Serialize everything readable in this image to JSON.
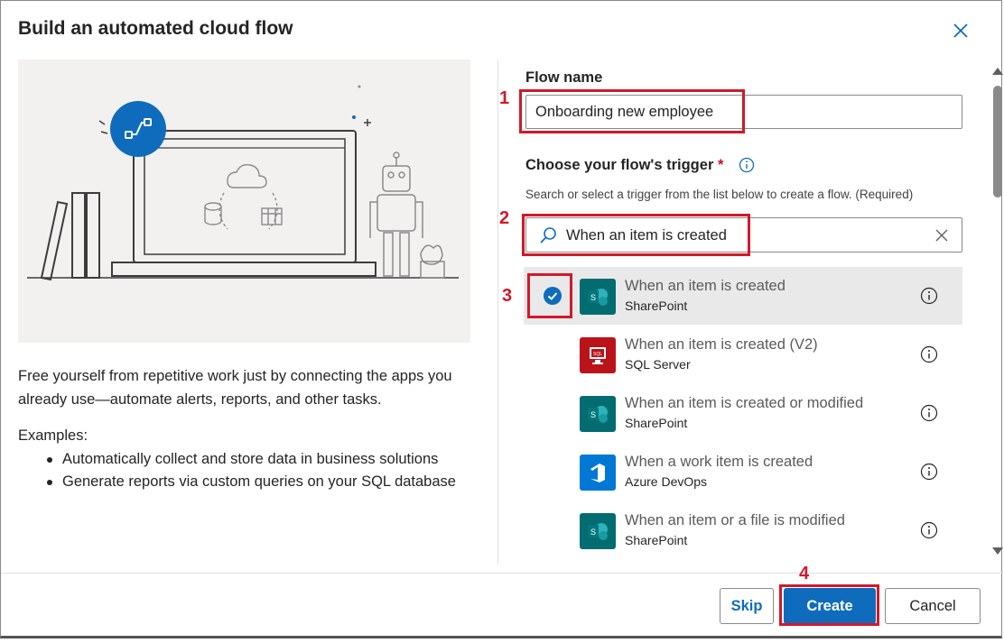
{
  "dialog": {
    "title": "Build an automated cloud flow",
    "description": "Free yourself from repetitive work just by connecting the apps you already use—automate alerts, reports, and other tasks.",
    "examples_heading": "Examples:",
    "examples": [
      "Automatically collect and store data in business solutions",
      "Generate reports via custom queries on your SQL database"
    ]
  },
  "form": {
    "flow_name_label": "Flow name",
    "flow_name_value": "Onboarding new employee",
    "trigger_label": "Choose your flow's trigger",
    "required_mark": "*",
    "trigger_hint": "Search or select a trigger from the list below to create a flow. (Required)",
    "search_value": "When an item is created"
  },
  "triggers": [
    {
      "name": "When an item is created",
      "connector": "SharePoint",
      "icon": "sharepoint-icon",
      "color": "#036c70",
      "selected": true
    },
    {
      "name": "When an item is created (V2)",
      "connector": "SQL Server",
      "icon": "sql-server-icon",
      "color": "#ba141a",
      "selected": false
    },
    {
      "name": "When an item is created or modified",
      "connector": "SharePoint",
      "icon": "sharepoint-icon",
      "color": "#036c70",
      "selected": false
    },
    {
      "name": "When a work item is created",
      "connector": "Azure DevOps",
      "icon": "azure-devops-icon",
      "color": "#0078d4",
      "selected": false
    },
    {
      "name": "When an item or a file is modified",
      "connector": "SharePoint",
      "icon": "sharepoint-icon",
      "color": "#036c70",
      "selected": false
    }
  ],
  "footer": {
    "skip_label": "Skip",
    "create_label": "Create",
    "cancel_label": "Cancel"
  },
  "annotations": [
    "1",
    "2",
    "3",
    "4"
  ],
  "colors": {
    "accent": "#0f6cbd",
    "annotation": "#d1192a",
    "selected_row": "#e9e9e9"
  }
}
